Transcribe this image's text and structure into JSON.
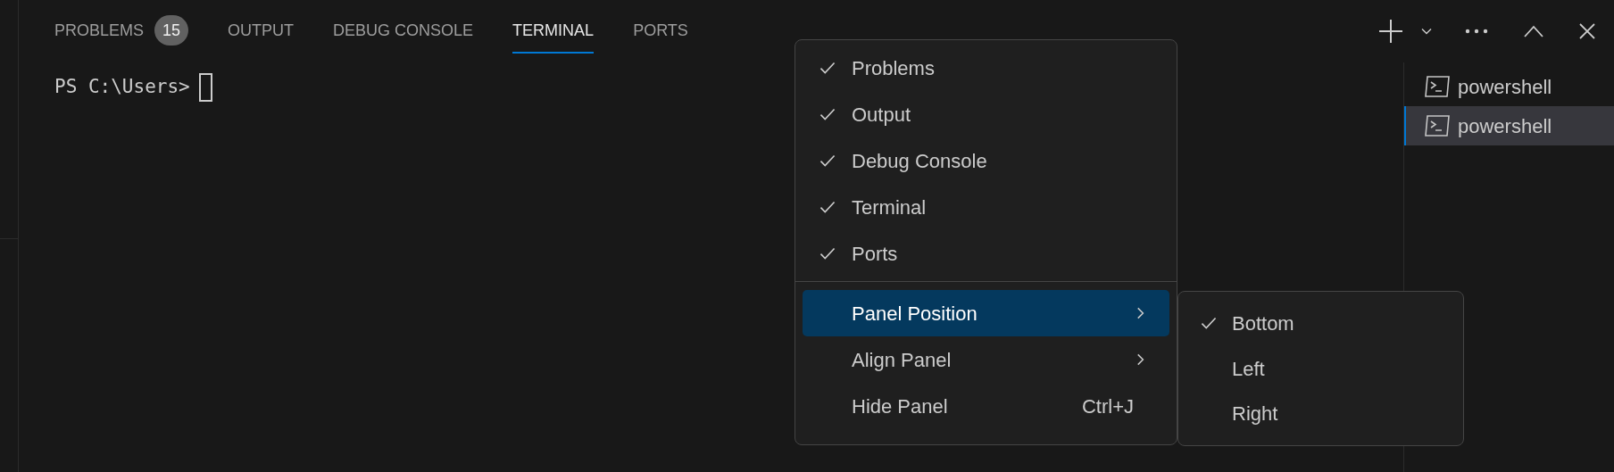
{
  "tabs": [
    {
      "label": "PROBLEMS",
      "selected": false,
      "badge": "15"
    },
    {
      "label": "OUTPUT",
      "selected": false
    },
    {
      "label": "DEBUG CONSOLE",
      "selected": false
    },
    {
      "label": "TERMINAL",
      "selected": true
    },
    {
      "label": "PORTS",
      "selected": false
    }
  ],
  "terminal": {
    "prompt": "PS C:\\Users>"
  },
  "terminal_list": [
    {
      "label": "powershell",
      "selected": false
    },
    {
      "label": "powershell",
      "selected": true
    }
  ],
  "context_menu": {
    "groups": [
      [
        {
          "kind": "check",
          "label": "Problems",
          "checked": true
        },
        {
          "kind": "check",
          "label": "Output",
          "checked": true
        },
        {
          "kind": "check",
          "label": "Debug Console",
          "checked": true
        },
        {
          "kind": "check",
          "label": "Terminal",
          "checked": true
        },
        {
          "kind": "check",
          "label": "Ports",
          "checked": true
        }
      ],
      [
        {
          "kind": "submenu",
          "label": "Panel Position",
          "selected": true
        },
        {
          "kind": "submenu",
          "label": "Align Panel",
          "selected": false
        },
        {
          "kind": "shortcut",
          "label": "Hide Panel",
          "shortcut": "Ctrl+J",
          "selected": false
        }
      ]
    ],
    "submenu": [
      {
        "label": "Bottom",
        "checked": true
      },
      {
        "label": "Left",
        "checked": false
      },
      {
        "label": "Right",
        "checked": false
      }
    ]
  }
}
